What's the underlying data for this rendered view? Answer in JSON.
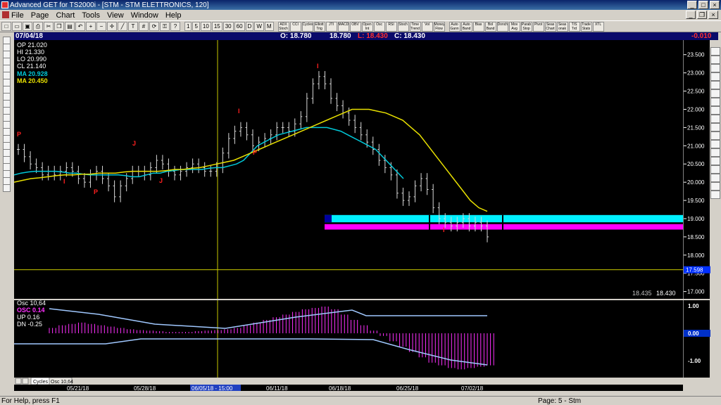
{
  "window": {
    "title": "Advanced GET for TS2000i - [STM - STM ELETTRONICS, 120]"
  },
  "menu": [
    "File",
    "Page",
    "Chart",
    "Tools",
    "View",
    "Window",
    "Help"
  ],
  "toolbar": {
    "periods": [
      "1",
      "5",
      "10",
      "15",
      "30",
      "60",
      "D",
      "W",
      "M"
    ],
    "studies": [
      "ADX Stoch",
      "CCI",
      "Cycles",
      "Elliott Trig",
      "JTI",
      "MACD",
      "OBV",
      "Open Int",
      "Osc",
      "RSI",
      "Stoch",
      "Time Trend",
      "Vol",
      "Money Flow"
    ],
    "tools": [
      "Auto Gann",
      "Auto Band",
      "Bias",
      "Bol Band",
      "Donch",
      "Mov Avg",
      "Parab Stop",
      "Pivot",
      "Seas Chart",
      "Seas onak",
      "T/S Trd",
      "Trade Stats",
      "XTL"
    ]
  },
  "info": {
    "date": "07/04/18",
    "open_label": "O: 18.780",
    "high_label": "18.780",
    "low_label": "L: 18.430",
    "close_label": "C: 18.430",
    "change": "-0.010"
  },
  "legend": {
    "op": "OP 21.020",
    "hi": "HI  21.330",
    "lo": "LO 20.990",
    "cl": "CL 21.140",
    "ma1": "MA 20.928",
    "ma2": "MA 20.450"
  },
  "colors": {
    "ma_fast": "#00c8d8",
    "ma_slow": "#e8e000",
    "osc": "#ff30ff",
    "bars": "#d8d8d8",
    "label_red": "#ff2020",
    "zone_cyan": "#00f0ff",
    "zone_magenta": "#ff00ff",
    "current_price": "#0030ff"
  },
  "price_axis": {
    "ticks": [
      "23.500",
      "23.000",
      "22.500",
      "22.000",
      "21.500",
      "21.000",
      "20.500",
      "20.000",
      "19.500",
      "19.000",
      "18.500",
      "18.000",
      "17.500",
      "17.000"
    ],
    "highlight": "17.598"
  },
  "bottom_price": {
    "left": "18.435",
    "right": "18.430"
  },
  "osc_legend": {
    "title": "Osc 10,64",
    "osc": "OSC 0.14",
    "up": "UP   0.16",
    "dn": "DN   -0.25"
  },
  "osc_axis": {
    "ticks": [
      "1.00",
      "0.00",
      "-1.00"
    ]
  },
  "tabs": [
    "Cycles",
    "Osc 10,64"
  ],
  "dates": [
    "05/21/18",
    "05/28/18",
    "06/05/18 - 15:00",
    "06/11/18",
    "06/18/18",
    "06/25/18",
    "07/02/18"
  ],
  "annotations": [
    "P",
    "I",
    "P",
    "J",
    "J",
    "I",
    "P",
    "I",
    "I"
  ],
  "status": {
    "help": "For Help, press F1",
    "page": "Page: 5 - Stm"
  },
  "chart_data": {
    "type": "ohlc",
    "y_range": [
      16.8,
      23.9
    ],
    "closes": [
      20.9,
      20.7,
      20.5,
      20.4,
      20.2,
      20.3,
      20.2,
      20.3,
      20.4,
      20.3,
      20.1,
      20.0,
      20.2,
      20.3,
      20.1,
      19.9,
      19.6,
      19.9,
      20.1,
      20.3,
      20.3,
      20.2,
      20.4,
      20.6,
      20.5,
      20.3,
      20.2,
      20.3,
      20.4,
      20.5,
      20.4,
      20.3,
      20.3,
      20.4,
      20.8,
      21.2,
      21.4,
      21.5,
      21.3,
      21.0,
      21.1,
      21.2,
      21.3,
      21.5,
      21.5,
      21.4,
      21.6,
      21.8,
      22.3,
      22.7,
      22.9,
      22.7,
      22.3,
      22.1,
      21.9,
      21.7,
      21.5,
      21.3,
      21.1,
      20.9,
      20.6,
      20.4,
      20.2,
      19.7,
      19.5,
      19.6,
      19.9,
      20.1,
      19.8,
      19.3,
      19.0,
      18.9,
      18.8,
      18.9,
      19.0,
      18.8,
      18.9,
      18.8,
      18.5
    ],
    "ma_fast": [
      20.2,
      20.25,
      20.28,
      20.3,
      20.3,
      20.3,
      20.3,
      20.28,
      20.25,
      20.25,
      20.22,
      20.2,
      20.2,
      20.2,
      20.2,
      20.2,
      20.18,
      20.15,
      20.15,
      20.2,
      20.25,
      20.25,
      20.3,
      20.32,
      20.35,
      20.35,
      20.35,
      20.35,
      20.38,
      20.4,
      20.4,
      20.45,
      20.5,
      20.6,
      20.8,
      21.0,
      21.1,
      21.2,
      21.3,
      21.35,
      21.4,
      21.45,
      21.5,
      21.5,
      21.5,
      21.5,
      21.45,
      21.4,
      21.3,
      21.2,
      21.1,
      21.0,
      20.9,
      20.7,
      20.5,
      20.3,
      20.1
    ],
    "ma_slow": [
      20.0,
      20.05,
      20.1,
      20.12,
      20.15,
      20.18,
      20.2,
      20.2,
      20.22,
      20.22,
      20.25,
      20.25,
      20.25,
      20.28,
      20.3,
      20.3,
      20.3,
      20.3,
      20.32,
      20.35,
      20.35,
      20.38,
      20.4,
      20.45,
      20.5,
      20.55,
      20.6,
      20.7,
      20.8,
      20.9,
      21.0,
      21.1,
      21.2,
      21.3,
      21.4,
      21.5,
      21.6,
      21.7,
      21.8,
      21.9,
      22.0,
      22.0,
      22.0,
      21.95,
      21.9,
      21.8,
      21.7,
      21.5,
      21.3,
      21.0,
      20.7,
      20.4,
      20.1,
      19.8,
      19.5,
      19.3,
      19.2
    ],
    "osc_values": [
      0.2,
      0.3,
      0.35,
      0.4,
      0.35,
      0.3,
      0.25,
      0.2,
      0.15,
      0.12,
      0.1,
      0.08,
      0.05,
      0.05,
      0.05,
      0.08,
      0.1,
      0.12,
      0.15,
      0.2,
      0.3,
      0.4,
      0.5,
      0.6,
      0.7,
      0.8,
      0.9,
      0.95,
      1.0,
      0.9,
      0.7,
      0.5,
      0.3,
      0.1,
      -0.1,
      -0.3,
      -0.5,
      -0.7,
      -0.9,
      -1.1,
      -1.2,
      -1.3,
      -1.35,
      -1.3,
      -1.25,
      -1.2
    ],
    "zone_upper": [
      18.9,
      19.1
    ],
    "zone_lower": [
      18.7,
      18.85
    ]
  }
}
